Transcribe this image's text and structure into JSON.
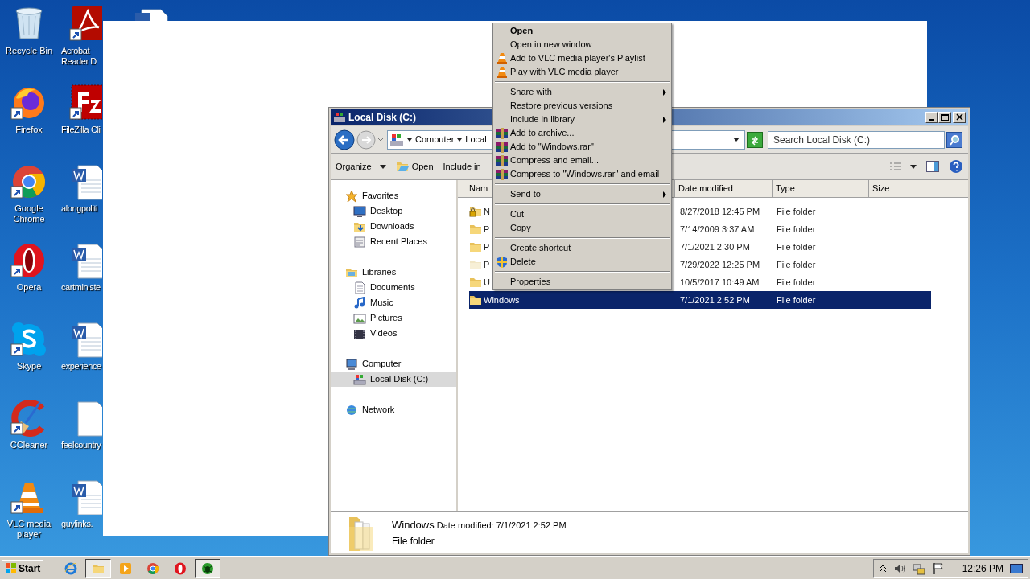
{
  "desktop_icons": [
    {
      "kind": "recycle",
      "label": "Recycle Bin",
      "shortcut": false
    },
    {
      "kind": "acrobat",
      "label": "Acrobat Reader D",
      "shortcut": true
    },
    {
      "kind": "firefox",
      "label": "Firefox",
      "shortcut": true
    },
    {
      "kind": "filezilla",
      "label": "FileZilla Cli",
      "shortcut": true
    },
    {
      "kind": "chrome",
      "label": "Google Chrome",
      "shortcut": true
    },
    {
      "kind": "word",
      "label": "alongpoliti",
      "shortcut": false
    },
    {
      "kind": "opera",
      "label": "Opera",
      "shortcut": true
    },
    {
      "kind": "word",
      "label": "cartministe",
      "shortcut": false
    },
    {
      "kind": "skype",
      "label": "Skype",
      "shortcut": true
    },
    {
      "kind": "word",
      "label": "experience",
      "shortcut": false
    },
    {
      "kind": "ccleaner",
      "label": "CCleaner",
      "shortcut": true
    },
    {
      "kind": "blankdoc",
      "label": "feelcountry",
      "shortcut": false
    },
    {
      "kind": "vlc",
      "label": "VLC media player",
      "shortcut": true
    },
    {
      "kind": "word",
      "label": "guylinks.",
      "shortcut": false
    }
  ],
  "explorer": {
    "title": "Local Disk (C:)",
    "address": [
      "Computer",
      "Local"
    ],
    "search": {
      "placeholder": "Search Local Disk (C:)"
    },
    "toolbar": [
      {
        "kind": "menu",
        "label": "Organize"
      },
      {
        "kind": "open",
        "label": "Open"
      },
      {
        "kind": "plain",
        "label": "Include in"
      }
    ],
    "nav": [
      {
        "kind": "star",
        "label": "Favorites",
        "selected": false,
        "children": [
          {
            "kind": "desktop",
            "label": "Desktop",
            "selected": false
          },
          {
            "kind": "downloads",
            "label": "Downloads",
            "selected": false
          },
          {
            "kind": "recent",
            "label": "Recent Places",
            "selected": false
          }
        ]
      },
      {
        "kind": "libraries",
        "label": "Libraries",
        "selected": false,
        "children": [
          {
            "kind": "documents",
            "label": "Documents",
            "selected": false
          },
          {
            "kind": "music",
            "label": "Music",
            "selected": false
          },
          {
            "kind": "pictures",
            "label": "Pictures",
            "selected": false
          },
          {
            "kind": "videos",
            "label": "Videos",
            "selected": false
          }
        ]
      },
      {
        "kind": "computer",
        "label": "Computer",
        "selected": false,
        "children": [
          {
            "kind": "disk",
            "label": "Local Disk (C:)",
            "selected": true
          }
        ]
      },
      {
        "kind": "network",
        "label": "Network",
        "selected": false
      }
    ],
    "columns": [
      "Nam",
      "Date modified",
      "Type",
      "Size"
    ],
    "rows": [
      {
        "kind": "locked",
        "name": "N",
        "date": "8/27/2018 12:45 PM",
        "type": "File folder",
        "selected": false
      },
      {
        "kind": "folder",
        "name": "P",
        "date": "7/14/2009 3:37 AM",
        "type": "File folder",
        "selected": false
      },
      {
        "kind": "folder",
        "name": "P",
        "date": "7/1/2021 2:30 PM",
        "type": "File folder",
        "selected": false
      },
      {
        "kind": "hidden",
        "name": "P",
        "date": "7/29/2022 12:25 PM",
        "type": "File folder",
        "selected": false
      },
      {
        "kind": "folder",
        "name": "U",
        "date": "10/5/2017 10:49 AM",
        "type": "File folder",
        "selected": false
      },
      {
        "kind": "folder",
        "name": "Windows",
        "date": "7/1/2021 2:52 PM",
        "type": "File folder",
        "selected": true
      }
    ],
    "details": {
      "name": "Windows",
      "modified": "Date modified: 7/1/2021 2:52 PM",
      "type": "File folder"
    }
  },
  "context_menu": [
    {
      "kind": "default",
      "label": "Open",
      "submenu": false
    },
    {
      "kind": "plain",
      "label": "Open in new window",
      "submenu": false
    },
    {
      "kind": "vlc",
      "label": "Add to VLC media player's Playlist",
      "submenu": false
    },
    {
      "kind": "vlc",
      "label": "Play with VLC media player",
      "submenu": false
    },
    {
      "kind": "separator"
    },
    {
      "kind": "plain",
      "label": "Share with",
      "submenu": true
    },
    {
      "kind": "plain",
      "label": "Restore previous versions",
      "submenu": false
    },
    {
      "kind": "plain",
      "label": "Include in library",
      "submenu": true
    },
    {
      "kind": "archive",
      "label": "Add to archive...",
      "submenu": false
    },
    {
      "kind": "archive",
      "label": "Add to \"Windows.rar\"",
      "submenu": false
    },
    {
      "kind": "archive",
      "label": "Compress and email...",
      "submenu": false
    },
    {
      "kind": "archive",
      "label": "Compress to \"Windows.rar\" and email",
      "submenu": false
    },
    {
      "kind": "separator"
    },
    {
      "kind": "plain",
      "label": "Send to",
      "submenu": true
    },
    {
      "kind": "separator"
    },
    {
      "kind": "plain",
      "label": "Cut",
      "submenu": false
    },
    {
      "kind": "plain",
      "label": "Copy",
      "submenu": false
    },
    {
      "kind": "separator"
    },
    {
      "kind": "plain",
      "label": "Create shortcut",
      "submenu": false
    },
    {
      "kind": "shield",
      "label": "Delete",
      "submenu": false
    },
    {
      "kind": "separator"
    },
    {
      "kind": "plain",
      "label": "Properties",
      "submenu": false
    }
  ],
  "taskbar": {
    "start": "Start",
    "apps": [
      {
        "kind": "ie",
        "selected": false
      },
      {
        "kind": "explorer",
        "selected": true
      },
      {
        "kind": "media",
        "selected": false
      },
      {
        "kind": "chrome",
        "selected": false
      },
      {
        "kind": "opera",
        "selected": false
      },
      {
        "kind": "bug",
        "selected": true
      }
    ],
    "clock": "12:26 PM"
  }
}
